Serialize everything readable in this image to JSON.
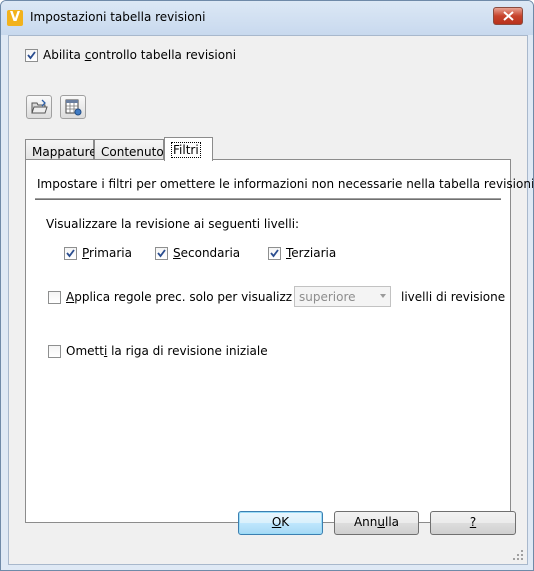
{
  "window": {
    "title": "Impostazioni tabella revisioni",
    "app_icon_letter": "V",
    "app_icon_color": "#f2b21c"
  },
  "enable_checkbox": {
    "label_pre": "Abilita ",
    "label_mnemonic": "c",
    "label_post": "ontrollo tabella revisioni",
    "checked": true
  },
  "toolbar": {
    "open_icon": "open-folder-icon",
    "table_icon": "table-settings-icon"
  },
  "tabs": [
    {
      "label": "Mappature",
      "active": false
    },
    {
      "label": "Contenuto",
      "active": false
    },
    {
      "label": "Filtri",
      "active": true
    }
  ],
  "filters": {
    "description": "Impostare i filtri per omettere le informazioni non necessarie nella tabella revisioni",
    "levels_heading": "Visualizzare la revisione ai seguenti livelli:",
    "levels": [
      {
        "mnemonic": "P",
        "rest": "rimaria",
        "checked": true
      },
      {
        "mnemonic": "S",
        "rest": "econdaria",
        "checked": true
      },
      {
        "mnemonic": "T",
        "rest": "erziaria",
        "checked": true
      }
    ],
    "apply_rules": {
      "mnemonic": "A",
      "rest": "pplica regole prec. solo per visualizz",
      "checked": false,
      "combo_value": "superiore",
      "suffix": "livelli di revisione"
    },
    "omit_initial": {
      "pre": "Omett",
      "mnemonic": "i",
      "post": " la riga di revisione iniziale",
      "checked": false
    }
  },
  "buttons": {
    "ok_mnemonic": "O",
    "ok_rest": "K",
    "cancel_pre": "Ann",
    "cancel_mnemonic": "u",
    "cancel_post": "lla",
    "help_mnemonic": "?"
  }
}
